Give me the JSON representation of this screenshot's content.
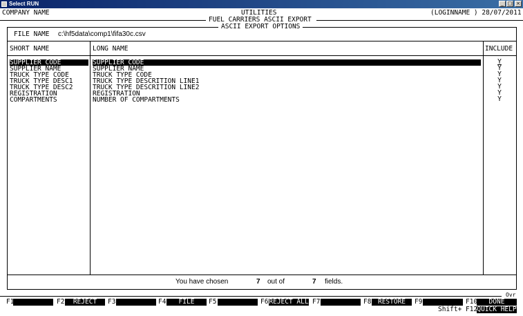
{
  "window": {
    "title": "Select RUN",
    "minimize": "_",
    "maximize": "□",
    "close": "×"
  },
  "header": {
    "company": "COMPANY NAME",
    "module": "UTILITIES",
    "subtitle": "FUEL CARRIERS ASCII EXPORT",
    "section": "ASCII EXPORT OPTIONS",
    "login": "(LOGINNAME ) 28/07/2011"
  },
  "file": {
    "label": "FILE NAME",
    "value": "c:\\hf5data\\comp1\\fifa30c.csv"
  },
  "columns": {
    "short": "SHORT NAME",
    "long": "LONG NAME",
    "include": "INCLUDE"
  },
  "fields": [
    {
      "short": "SUPPLIER CODE",
      "long": "SUPPLIER CODE",
      "include": "Y",
      "selected": true
    },
    {
      "short": "SUPPLIER NAME",
      "long": "SUPPLIER NAME",
      "include": "Y",
      "selected": false
    },
    {
      "short": "TRUCK TYPE CODE",
      "long": "TRUCK TYPE CODE",
      "include": "Y",
      "selected": false
    },
    {
      "short": "TRUCK TYPE DESC1",
      "long": "TRUCK TYPE DESCRITION LINE1",
      "include": "Y",
      "selected": false
    },
    {
      "short": "TRUCK TYPE DESC2",
      "long": "TRUCK TYPE DESCRITION LINE2",
      "include": "Y",
      "selected": false
    },
    {
      "short": "REGISTRATION",
      "long": "REGISTRATION",
      "include": "Y",
      "selected": false
    },
    {
      "short": "COMPARTMENTS",
      "long": "NUMBER OF COMPARTMENTS",
      "include": "Y",
      "selected": false
    }
  ],
  "summary": {
    "prefix": "You have chosen",
    "chosen": "7",
    "middle": "out of",
    "total": "7",
    "suffix": "fields."
  },
  "mode": "Ovr",
  "fkeys": {
    "f1": {
      "key": "F1",
      "label": ""
    },
    "f2": {
      "key": "F2",
      "label": "REJECT"
    },
    "f3": {
      "key": "F3",
      "label": ""
    },
    "f4": {
      "key": "F4",
      "label": "FILE"
    },
    "f5": {
      "key": "F5",
      "label": ""
    },
    "f6": {
      "key": "F6",
      "label": "REJECT ALL"
    },
    "f7": {
      "key": "F7",
      "label": ""
    },
    "f8": {
      "key": "F8",
      "label": "RESTORE"
    },
    "f9": {
      "key": "F9",
      "label": ""
    },
    "f10": {
      "key": "F10",
      "label": "DONE"
    },
    "sf12": {
      "key": "Shift+ F12",
      "label": "QUICK HELP"
    }
  }
}
